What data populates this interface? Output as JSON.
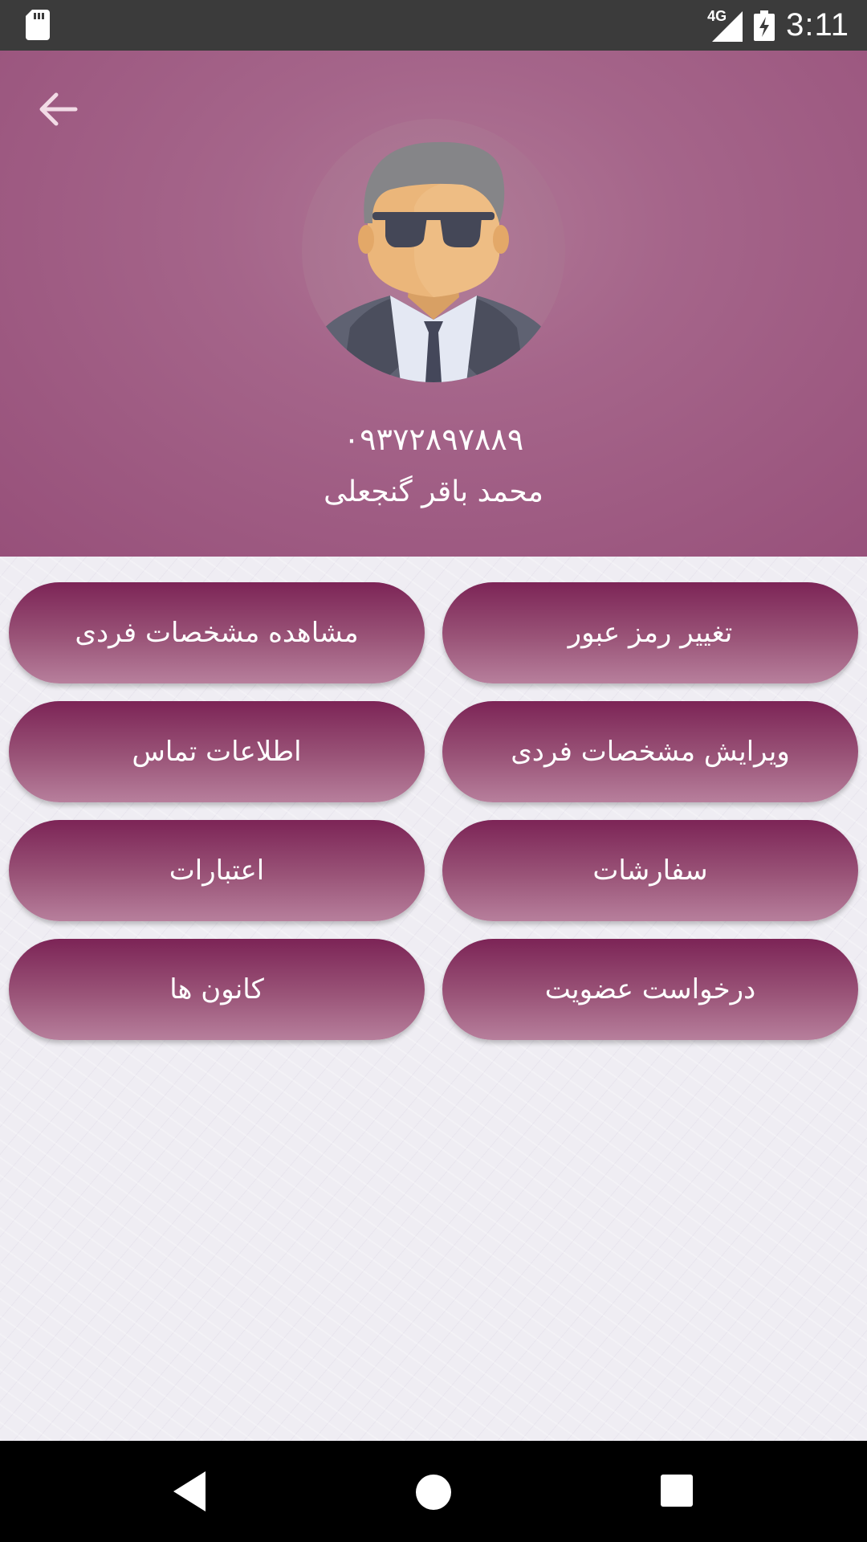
{
  "status_bar": {
    "time": "3:11",
    "network": "4G",
    "icons": [
      "sd-card-icon",
      "signal-icon",
      "battery-charging-icon"
    ]
  },
  "header": {
    "phone": "۰۹۳۷۲۸۹۷۸۸۹",
    "name": "محمد باقر گنجعلی",
    "colors": {
      "background": "#a5658a"
    }
  },
  "menu": {
    "buttons": [
      {
        "label": "تغییر رمز عبور"
      },
      {
        "label": "مشاهده مشخصات فردی"
      },
      {
        "label": "ویرایش مشخصات فردی"
      },
      {
        "label": "اطلاعات تماس"
      },
      {
        "label": "سفارشات"
      },
      {
        "label": "اعتبارات"
      },
      {
        "label": "درخواست عضویت"
      },
      {
        "label": "کانون ها"
      }
    ],
    "button_color": "#8a3a66"
  },
  "nav_bar": {
    "icons": [
      "back-triangle-icon",
      "home-circle-icon",
      "recents-square-icon"
    ]
  }
}
